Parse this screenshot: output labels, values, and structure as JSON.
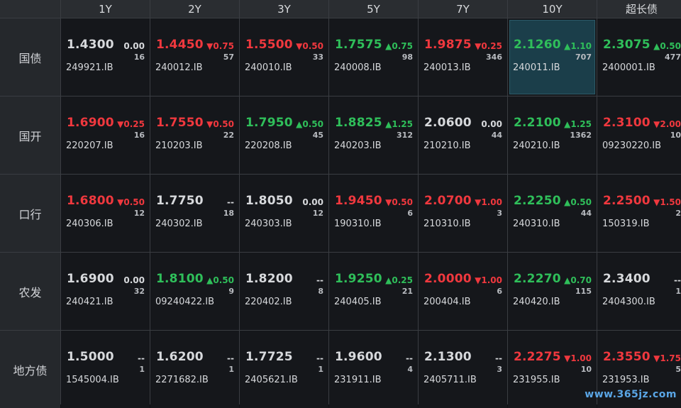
{
  "columns": [
    "1Y",
    "2Y",
    "3Y",
    "5Y",
    "7Y",
    "10Y",
    "超长债"
  ],
  "watermark": "www.365jz.com",
  "colors": {
    "up": "#2fbf5a",
    "down": "#f0383e",
    "flat": "#d7d9dc",
    "selected_bg": "#1b3e4a"
  },
  "rows": [
    {
      "label": "国债",
      "cells": [
        {
          "price": "1.4300",
          "change": "0.00",
          "dir": "flat",
          "volume": "16",
          "code": "249921.IB"
        },
        {
          "price": "1.4450",
          "change": "▼0.75",
          "dir": "down",
          "volume": "57",
          "code": "240012.IB"
        },
        {
          "price": "1.5500",
          "change": "▼0.50",
          "dir": "down",
          "volume": "33",
          "code": "240010.IB"
        },
        {
          "price": "1.7575",
          "change": "▲0.75",
          "dir": "up",
          "volume": "98",
          "code": "240008.IB"
        },
        {
          "price": "1.9875",
          "change": "▼0.25",
          "dir": "down",
          "volume": "346",
          "code": "240013.IB"
        },
        {
          "price": "2.1260",
          "change": "▲1.10",
          "dir": "up",
          "volume": "707",
          "code": "240011.IB",
          "selected": true
        },
        {
          "price": "2.3075",
          "change": "▲0.50",
          "dir": "up",
          "volume": "477",
          "code": "2400001.IB"
        }
      ]
    },
    {
      "label": "国开",
      "cells": [
        {
          "price": "1.6900",
          "change": "▼0.25",
          "dir": "down",
          "volume": "16",
          "code": "220207.IB"
        },
        {
          "price": "1.7550",
          "change": "▼0.50",
          "dir": "down",
          "volume": "22",
          "code": "210203.IB"
        },
        {
          "price": "1.7950",
          "change": "▲0.50",
          "dir": "up",
          "volume": "45",
          "code": "220208.IB"
        },
        {
          "price": "1.8825",
          "change": "▲1.25",
          "dir": "up",
          "volume": "312",
          "code": "240203.IB"
        },
        {
          "price": "2.0600",
          "change": "0.00",
          "dir": "flat",
          "volume": "44",
          "code": "210210.IB"
        },
        {
          "price": "2.2100",
          "change": "▲1.25",
          "dir": "up",
          "volume": "1362",
          "code": "240210.IB"
        },
        {
          "price": "2.3100",
          "change": "▼2.00",
          "dir": "down",
          "volume": "10",
          "code": "09230220.IB"
        }
      ]
    },
    {
      "label": "口行",
      "cells": [
        {
          "price": "1.6800",
          "change": "▼0.50",
          "dir": "down",
          "volume": "12",
          "code": "240306.IB"
        },
        {
          "price": "1.7750",
          "change": "--",
          "dir": "flat",
          "volume": "18",
          "code": "240302.IB"
        },
        {
          "price": "1.8050",
          "change": "0.00",
          "dir": "flat",
          "volume": "12",
          "code": "240303.IB"
        },
        {
          "price": "1.9450",
          "change": "▼0.50",
          "dir": "down",
          "volume": "6",
          "code": "190310.IB"
        },
        {
          "price": "2.0700",
          "change": "▼1.00",
          "dir": "down",
          "volume": "3",
          "code": "210310.IB"
        },
        {
          "price": "2.2250",
          "change": "▲0.50",
          "dir": "up",
          "volume": "44",
          "code": "240310.IB"
        },
        {
          "price": "2.2500",
          "change": "▼1.50",
          "dir": "down",
          "volume": "2",
          "code": "150319.IB"
        }
      ]
    },
    {
      "label": "农发",
      "cells": [
        {
          "price": "1.6900",
          "change": "0.00",
          "dir": "flat",
          "volume": "32",
          "code": "240421.IB"
        },
        {
          "price": "1.8100",
          "change": "▲0.50",
          "dir": "up",
          "volume": "9",
          "code": "09240422.IB"
        },
        {
          "price": "1.8200",
          "change": "--",
          "dir": "flat",
          "volume": "8",
          "code": "220402.IB"
        },
        {
          "price": "1.9250",
          "change": "▲0.25",
          "dir": "up",
          "volume": "21",
          "code": "240405.IB"
        },
        {
          "price": "2.0000",
          "change": "▼1.00",
          "dir": "down",
          "volume": "6",
          "code": "200404.IB"
        },
        {
          "price": "2.2270",
          "change": "▲0.70",
          "dir": "up",
          "volume": "115",
          "code": "240420.IB"
        },
        {
          "price": "2.3400",
          "change": "--",
          "dir": "flat",
          "volume": "1",
          "code": "2404300.IB"
        }
      ]
    },
    {
      "label": "地方债",
      "cells": [
        {
          "price": "1.5000",
          "change": "--",
          "dir": "flat",
          "volume": "1",
          "code": "1545004.IB"
        },
        {
          "price": "1.6200",
          "change": "--",
          "dir": "flat",
          "volume": "1",
          "code": "2271682.IB"
        },
        {
          "price": "1.7725",
          "change": "--",
          "dir": "flat",
          "volume": "1",
          "code": "2405621.IB"
        },
        {
          "price": "1.9600",
          "change": "--",
          "dir": "flat",
          "volume": "4",
          "code": "231911.IB"
        },
        {
          "price": "2.1300",
          "change": "--",
          "dir": "flat",
          "volume": "3",
          "code": "2405711.IB"
        },
        {
          "price": "2.2275",
          "change": "▼1.00",
          "dir": "down",
          "volume": "10",
          "code": "231955.IB"
        },
        {
          "price": "2.3550",
          "change": "▼1.75",
          "dir": "down",
          "volume": "5",
          "code": "231953.IB"
        }
      ]
    }
  ]
}
